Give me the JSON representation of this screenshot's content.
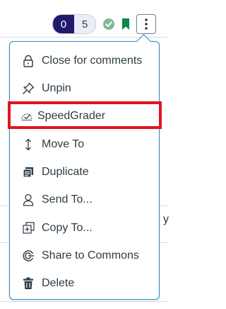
{
  "toolbar": {
    "unread_count": "0",
    "total_count": "5",
    "published_icon": "check-circle-icon",
    "bookmark_icon": "bookmark-icon",
    "more_icon": "kebab-icon"
  },
  "menu": {
    "items": [
      {
        "label": "Close for comments",
        "icon": "lock-icon"
      },
      {
        "label": "Unpin",
        "icon": "pin-icon"
      },
      {
        "label": "SpeedGrader",
        "icon": "speedgrader-icon"
      },
      {
        "label": "Move To",
        "icon": "move-icon"
      },
      {
        "label": "Duplicate",
        "icon": "duplicate-icon"
      },
      {
        "label": "Send To...",
        "icon": "user-icon"
      },
      {
        "label": "Copy To...",
        "icon": "copy-icon"
      },
      {
        "label": "Share to Commons",
        "icon": "commons-icon"
      },
      {
        "label": "Delete",
        "icon": "trash-icon"
      }
    ]
  },
  "colors": {
    "unread_bg": "#1f1a6b",
    "published_green": "#7fb89a",
    "bookmark_green": "#0b874b",
    "menu_border": "#2b8bc6",
    "highlight_red": "#e0141e",
    "text": "#2d3b45"
  }
}
